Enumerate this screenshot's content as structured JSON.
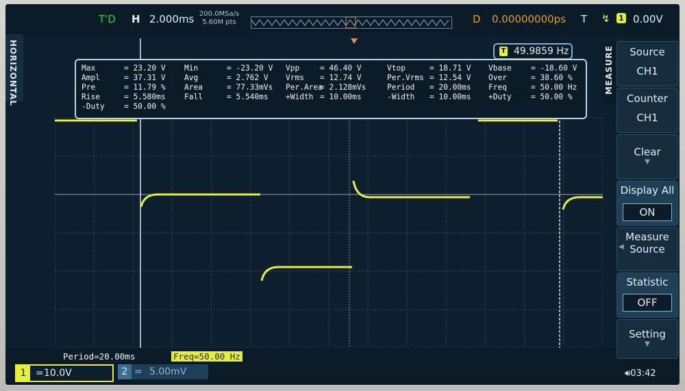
{
  "top": {
    "trig_status": "T'D",
    "h_label": "H",
    "timebase": "2.000ms",
    "sample_rate": "200.0MSa/s",
    "mem_depth": "5.60M pts",
    "delay_label": "D",
    "delay_value": "0.00000000ps",
    "trig_label": "T",
    "trig_channel": "1",
    "trig_level": "0.00V"
  },
  "side_tab": "HORIZONTAL",
  "counter": {
    "icon": "T",
    "value": "49.9859 Hz"
  },
  "measurements": [
    [
      [
        "Max",
        "= 23.20 V"
      ],
      [
        "Min",
        "= -23.20 V"
      ],
      [
        "Vpp",
        "= 46.40 V"
      ],
      [
        "Vtop",
        "= 18.71 V"
      ],
      [
        "Vbase",
        "= -18.60 V"
      ]
    ],
    [
      [
        "Ampl",
        "= 37.31 V"
      ],
      [
        "Avg",
        "= 2.762 V"
      ],
      [
        "Vrms",
        "= 12.74 V"
      ],
      [
        "Per.Vrms",
        "= 12.54 V"
      ],
      [
        "Over",
        "= 38.60 %"
      ]
    ],
    [
      [
        "Pre",
        "= 11.79 %"
      ],
      [
        "Area",
        "= 77.33mVs"
      ],
      [
        "Per.Area",
        "= 2.128mVs"
      ],
      [
        "Period",
        "= 20.00ms"
      ],
      [
        "Freq",
        "= 50.00 Hz"
      ]
    ],
    [
      [
        "Rise",
        "= 5.580ms"
      ],
      [
        "Fall",
        "= 5.540ms"
      ],
      [
        "+Width",
        "= 10.00ms"
      ],
      [
        "-Width",
        "= 10.00ms"
      ],
      [
        "+Duty",
        "= 50.00 %"
      ]
    ],
    [
      [
        "-Duty",
        "= 50.00 %"
      ]
    ]
  ],
  "bottom": {
    "period": "Period=20.00ms",
    "freq": "Freq=50.00 Hz",
    "ch1_num": "1",
    "ch1_coupling": "=",
    "ch1_scale": "10.0V",
    "ch2_num": "2",
    "ch2_coupling": "=",
    "ch2_scale": "5.00mV",
    "time": "03:42"
  },
  "ch1_marker": "1",
  "menu": {
    "title": "MEASURE",
    "items": [
      {
        "label": "Source",
        "value": "CH1"
      },
      {
        "label": "Counter",
        "value": "CH1"
      },
      {
        "label": "Clear",
        "value": ""
      },
      {
        "label": "Display All",
        "value": "ON"
      },
      {
        "label": "Measure Source",
        "value": ""
      },
      {
        "label": "Statistic",
        "value": "OFF"
      },
      {
        "label": "Setting",
        "value": ""
      }
    ]
  },
  "colors": {
    "ch1": "#e7ef3a",
    "grid": "#5c7384",
    "background": "#0d1f2c"
  }
}
